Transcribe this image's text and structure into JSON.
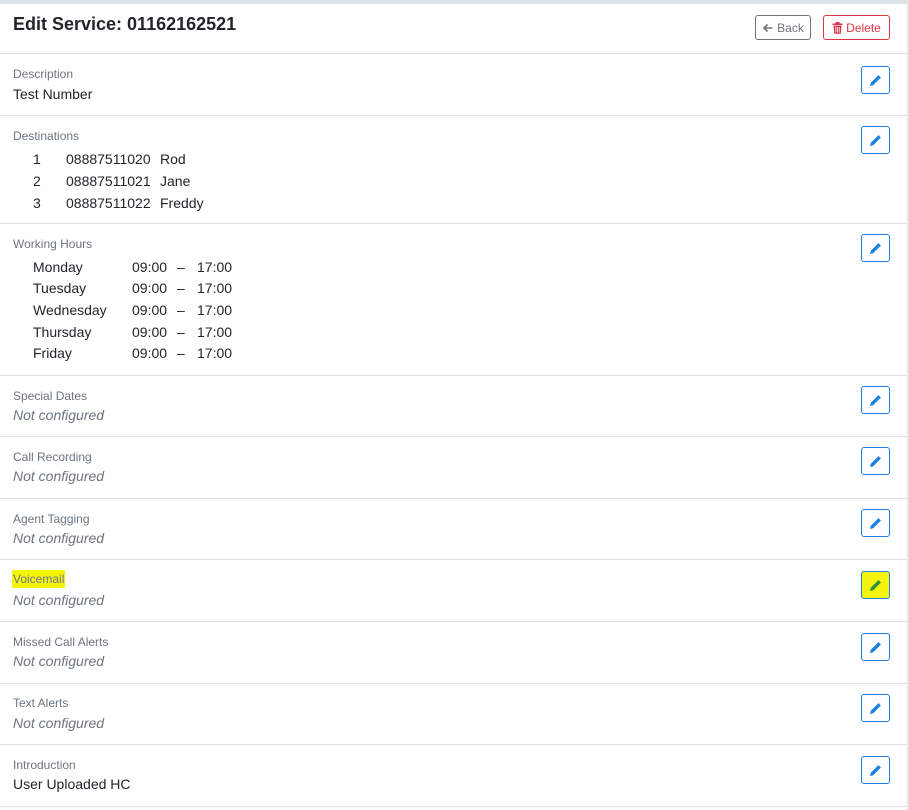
{
  "header": {
    "title": "Edit Service: 01162162521",
    "back_label": "Back",
    "delete_label": "Delete"
  },
  "description": {
    "label": "Description",
    "value": "Test Number"
  },
  "destinations": {
    "label": "Destinations",
    "rows": [
      {
        "index": "1",
        "number": "08887511020",
        "name": "Rod"
      },
      {
        "index": "2",
        "number": "08887511021",
        "name": "Jane"
      },
      {
        "index": "3",
        "number": "08887511022",
        "name": "Freddy"
      }
    ]
  },
  "working_hours": {
    "label": "Working Hours",
    "rows": [
      {
        "day": "Monday",
        "start": "09:00",
        "dash": "–",
        "end": "17:00"
      },
      {
        "day": "Tuesday",
        "start": "09:00",
        "dash": "–",
        "end": "17:00"
      },
      {
        "day": "Wednesday",
        "start": "09:00",
        "dash": "–",
        "end": "17:00"
      },
      {
        "day": "Thursday",
        "start": "09:00",
        "dash": "–",
        "end": "17:00"
      },
      {
        "day": "Friday",
        "start": "09:00",
        "dash": "–",
        "end": "17:00"
      }
    ]
  },
  "special_dates": {
    "label": "Special Dates",
    "value": "Not configured"
  },
  "call_recording": {
    "label": "Call Recording",
    "value": "Not configured"
  },
  "agent_tagging": {
    "label": "Agent Tagging",
    "value": "Not configured"
  },
  "voicemail": {
    "label": "Voicemail",
    "value": "Not configured"
  },
  "missed_call_alerts": {
    "label": "Missed Call Alerts",
    "value": "Not configured"
  },
  "text_alerts": {
    "label": "Text Alerts",
    "value": "Not configured"
  },
  "introduction": {
    "label": "Introduction",
    "value": "User Uploaded HC"
  },
  "icons": {
    "edit": "pencil-icon",
    "back": "arrow-left-icon",
    "delete": "trash-icon"
  },
  "colors": {
    "primary": "#1a7fe0",
    "danger": "#dc3545",
    "secondary": "#6c757d",
    "highlight": "#f4f40d"
  }
}
